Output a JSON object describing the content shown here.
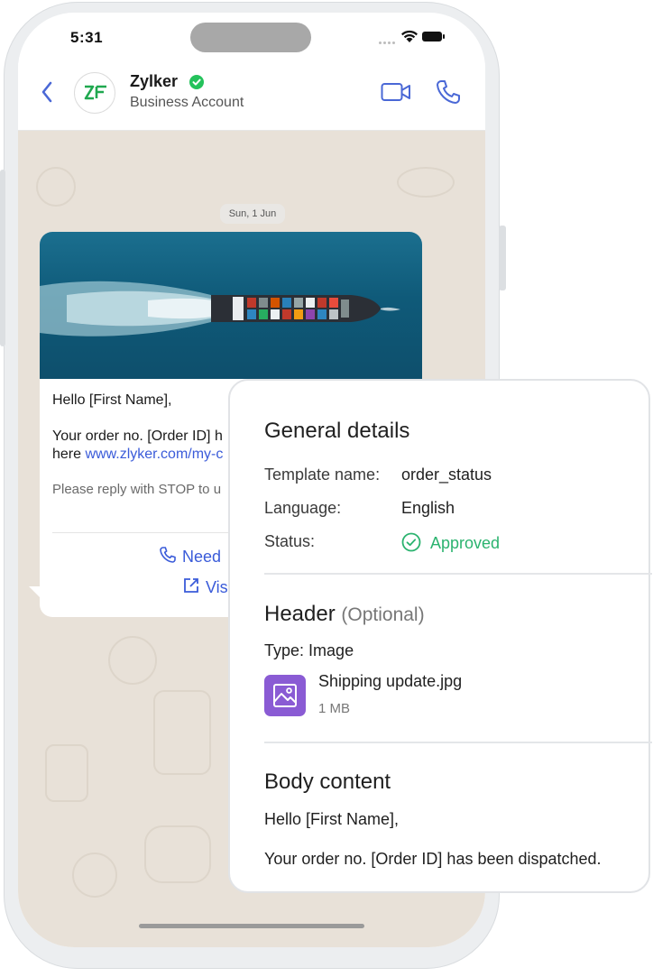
{
  "status_bar": {
    "time": "5:31"
  },
  "chat_header": {
    "contact_name": "Zylker",
    "contact_subtitle": "Business Account",
    "avatar_logo": "ZF"
  },
  "chat": {
    "date_label": "Sun, 1 Jun",
    "message": {
      "image_alt": "Container ship at sea",
      "greeting": "Hello [First Name],",
      "line1": "Your order no. [Order ID] h",
      "line2_prefix": "here ",
      "line2_link": "www.zlyker.com/my-c",
      "footer": "Please reply with STOP to u",
      "button_call": "Need",
      "button_visit": "Vis"
    }
  },
  "details": {
    "general_title": "General details",
    "template_name_label": "Template name:",
    "template_name_value": "order_status",
    "language_label": "Language:",
    "language_value": "English",
    "status_label": "Status:",
    "status_value": "Approved",
    "header_title": "Header",
    "header_optional": "(Optional)",
    "type_label": "Type:",
    "type_value": "Image",
    "file_name": "Shipping update.jpg",
    "file_size": "1 MB",
    "body_title": "Body content",
    "body_line1": "Hello [First Name],",
    "body_line2": "Your order no. [Order ID] has been dispatched."
  },
  "colors": {
    "accent": "#3a5bd9",
    "verified": "#24c25b",
    "approved": "#2bb36f",
    "file_icon": "#8a5bd4",
    "chat_background": "#e8e1d8"
  },
  "icons": [
    "back-chevron-icon",
    "verified-check-icon",
    "video-call-icon",
    "phone-call-icon",
    "wifi-icon",
    "battery-icon",
    "phone-icon",
    "external-link-icon",
    "check-circle-icon",
    "image-file-icon"
  ]
}
